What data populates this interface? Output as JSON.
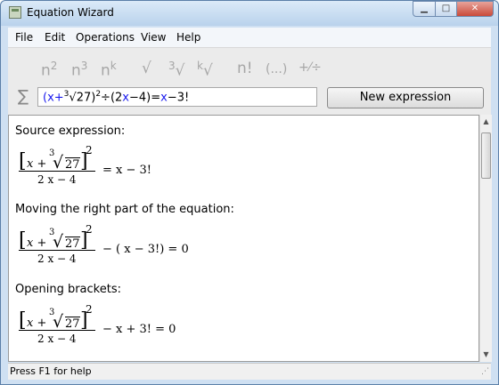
{
  "window": {
    "title": "Equation Wizard"
  },
  "window_buttons": {
    "minimize": "▁",
    "maximize": "□",
    "close": "✕"
  },
  "menu": [
    "File",
    "Edit",
    "Operations",
    "View",
    "Help"
  ],
  "toolbar": {
    "tools": [
      {
        "base": "n",
        "sup": "2"
      },
      {
        "base": "n",
        "sup": "3"
      },
      {
        "base": "n",
        "sup": "k"
      },
      {
        "base": "√",
        "sup": ""
      },
      {
        "base": "√",
        "pre": "3"
      },
      {
        "base": "√",
        "pre": "k"
      },
      {
        "base": "n!",
        "sup": ""
      },
      {
        "base": "(...)",
        "sup": ""
      },
      {
        "base": "+⁄÷",
        "sup": ""
      }
    ],
    "sigma": "∑",
    "expression": {
      "part1": "(x+",
      "pre3": "3",
      "part2": "√27)",
      "exp": "2",
      "part3": "÷(2",
      "x": "x",
      "part4": "−4)=",
      "x2": "x",
      "part5": "−3!"
    },
    "new_button": "New expression"
  },
  "content": {
    "sections": [
      {
        "label": "Source expression:",
        "rest": "= x − 3!"
      },
      {
        "label": "Moving the right part of the equation:",
        "rest": "− ( x − 3!) = 0"
      },
      {
        "label": "Opening brackets:",
        "rest": "− x + 3! = 0"
      }
    ],
    "numerator": {
      "lb": "[",
      "x": "x +",
      "root_index": "3",
      "radical": "√",
      "radicand": "27",
      "rb": "]",
      "power": "2"
    },
    "denominator": "2 x − 4"
  },
  "scrollbar": {
    "up": "▲",
    "down": "▼"
  },
  "status": {
    "text": "Press F1 for help",
    "grip": "⋰"
  }
}
